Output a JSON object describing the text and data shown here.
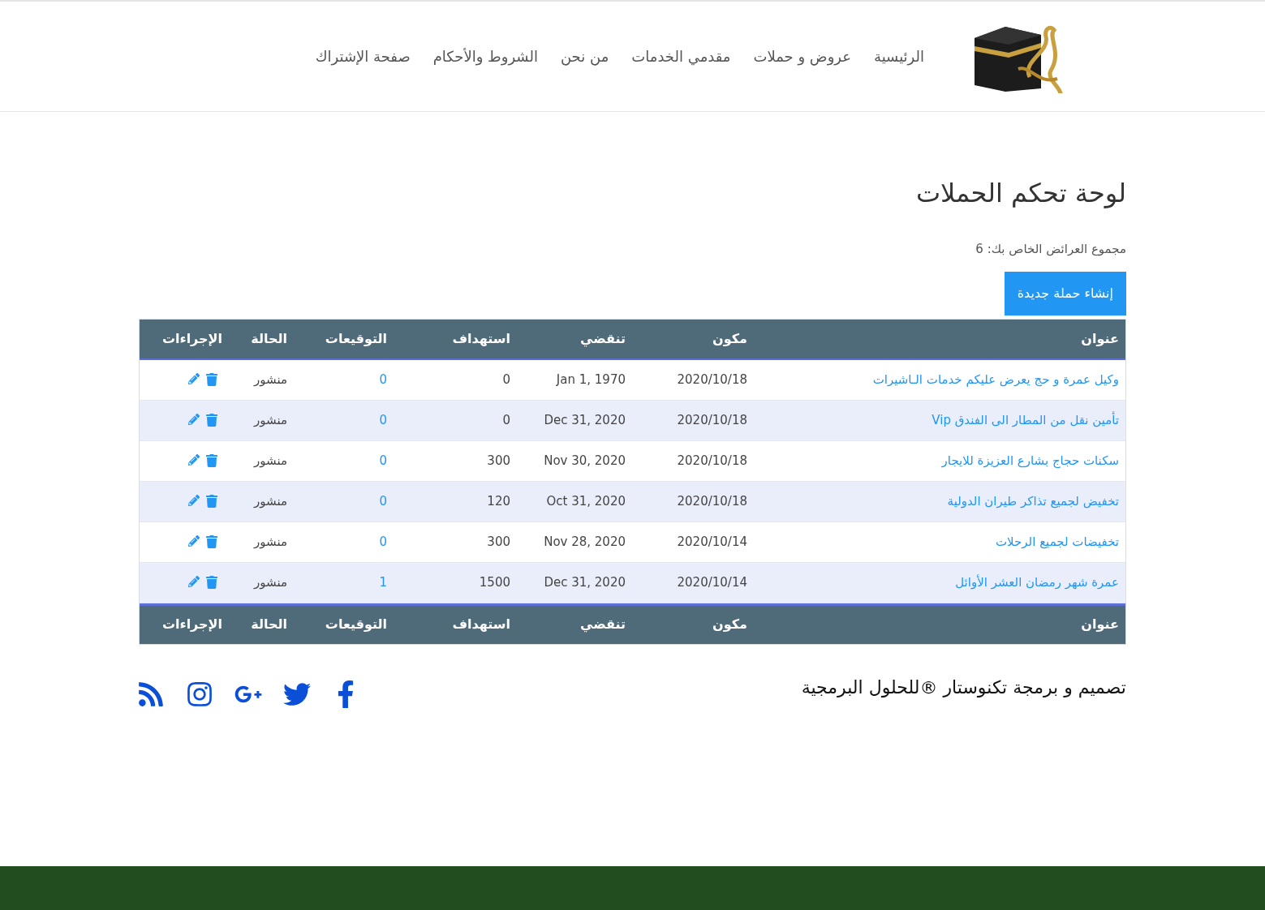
{
  "nav": [
    {
      "label": "الرئيسية"
    },
    {
      "label": "عروض و حملات"
    },
    {
      "label": "مقدمي الخدمات"
    },
    {
      "label": "من نحن"
    },
    {
      "label": "الشروط والأحكام"
    },
    {
      "label": "صفحة الإشتراك"
    }
  ],
  "page_title": "لوحة تحكم الحملات",
  "summary": "مجموع العرائض الخاص بك: 6",
  "create_button": "إنشاء حملة جديدة",
  "table": {
    "columns": [
      "عنوان",
      "مكون",
      "تنقضي",
      "استهداف",
      "التوقيعات",
      "الحالة",
      "الإجراءات"
    ],
    "footer_columns": [
      "عنوان",
      "مكون",
      "تنقضي",
      "استهداف",
      "التوقيعات",
      "الحالة",
      "الإجراءات"
    ],
    "rows": [
      {
        "title": "وكيل عمرة و حج يعرض عليكم خدمات الـاشيرات",
        "created": "2020/10/18",
        "expires": "Jan 1, 1970",
        "target": "0",
        "signatures": "0",
        "status": "منشور"
      },
      {
        "title": "تأمين نقل من المطار الى الفندق Vip",
        "created": "2020/10/18",
        "expires": "Dec 31, 2020",
        "target": "0",
        "signatures": "0",
        "status": "منشور"
      },
      {
        "title": "سكنات حجاج بشارع العزيزة للايجار",
        "created": "2020/10/18",
        "expires": "Nov 30, 2020",
        "target": "300",
        "signatures": "0",
        "status": "منشور"
      },
      {
        "title": "تخفيض لجميع تذاكر طيران الدولية",
        "created": "2020/10/18",
        "expires": "Oct 31, 2020",
        "target": "120",
        "signatures": "0",
        "status": "منشور"
      },
      {
        "title": "تخفيضات لجميع الرحلات",
        "created": "2020/10/14",
        "expires": "Nov 28, 2020",
        "target": "300",
        "signatures": "0",
        "status": "منشور"
      },
      {
        "title": "عمرة شهر رمضان العشر الأوائل",
        "created": "2020/10/14",
        "expires": "Dec 31, 2020",
        "target": "1500",
        "signatures": "1",
        "status": "منشور"
      }
    ]
  },
  "footer_credit": "تصميم و برمجة تكنوستار ®للحلول البرمجية",
  "social": [
    {
      "kind": "facebook"
    },
    {
      "kind": "twitter"
    },
    {
      "kind": "google-plus"
    },
    {
      "kind": "instagram"
    },
    {
      "kind": "rss"
    }
  ]
}
